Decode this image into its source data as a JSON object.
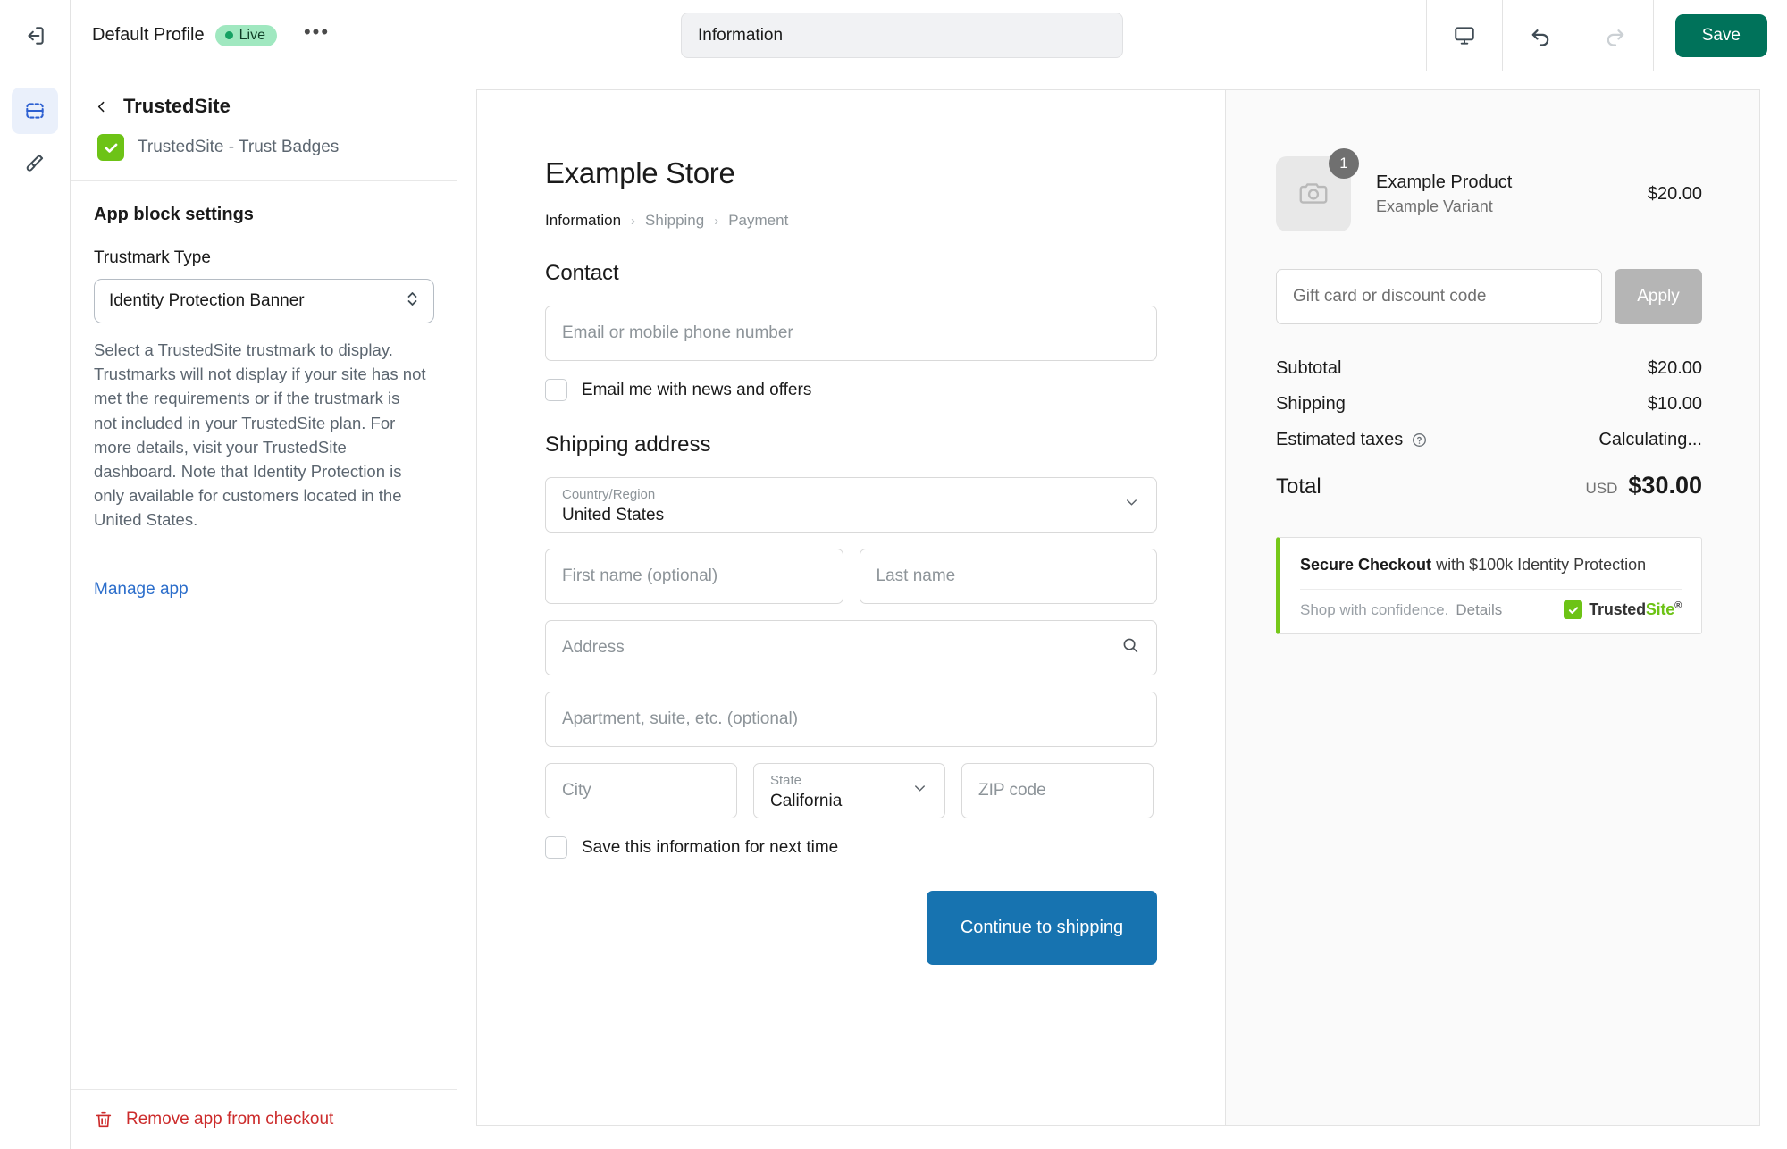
{
  "topbar": {
    "exit_icon": "exit-icon",
    "profile_name": "Default Profile",
    "status_label": "Live",
    "more_label": "•••",
    "page_selector_value": "Information",
    "preview_device_icon": "desktop-icon",
    "undo_icon": "undo-icon",
    "redo_icon": "redo-icon",
    "save_label": "Save"
  },
  "rail": {
    "items": [
      {
        "icon": "sections-icon",
        "name": "sections",
        "active": true
      },
      {
        "icon": "paintbrush-icon",
        "name": "design",
        "active": false
      }
    ]
  },
  "sidebar": {
    "back_icon": "chevron-left-icon",
    "title": "TrustedSite",
    "app_badge_icon": "trustedsite-check-icon",
    "app_name": "TrustedSite - Trust Badges",
    "section_title": "App block settings",
    "trustmark_label": "Trustmark Type",
    "trustmark_value": "Identity Protection Banner",
    "trustmark_options": [
      "Identity Protection Banner"
    ],
    "help_text": "Select a TrustedSite trustmark to display. Trustmarks will not display if your site has not met the requirements or if the trustmark is not included in your TrustedSite plan. For more details, visit your TrustedSite dashboard. Note that Identity Protection is only available for customers located in the United States.",
    "manage_app_label": "Manage app",
    "remove_label": "Remove app from checkout",
    "remove_icon": "trash-icon"
  },
  "checkout": {
    "store_name": "Example Store",
    "breadcrumb": [
      {
        "label": "Information",
        "active": true
      },
      {
        "label": "Shipping",
        "active": false
      },
      {
        "label": "Payment",
        "active": false
      }
    ],
    "breadcrumb_sep": "›",
    "contact_title": "Contact",
    "email_placeholder": "Email or mobile phone number",
    "newsletter_label": "Email me with news and offers",
    "shipping_title": "Shipping address",
    "country_label": "Country/Region",
    "country_value": "United States",
    "first_name_placeholder": "First name (optional)",
    "last_name_placeholder": "Last name",
    "address_placeholder": "Address",
    "address_icon": "search-icon",
    "apartment_placeholder": "Apartment, suite, etc. (optional)",
    "city_placeholder": "City",
    "state_label": "State",
    "state_value": "California",
    "zip_placeholder": "ZIP code",
    "save_info_label": "Save this information for next time",
    "continue_label": "Continue to shipping"
  },
  "summary": {
    "product_thumb_icon": "camera-placeholder-icon",
    "product_qty": "1",
    "product_name": "Example Product",
    "product_variant": "Example Variant",
    "product_price": "$20.00",
    "discount_placeholder": "Gift card or discount code",
    "apply_label": "Apply",
    "lines": [
      {
        "label": "Subtotal",
        "value": "$20.00",
        "info_icon": false
      },
      {
        "label": "Shipping",
        "value": "$10.00",
        "info_icon": false
      },
      {
        "label": "Estimated taxes",
        "value": "Calculating...",
        "info_icon": true
      }
    ],
    "total_label": "Total",
    "total_currency": "USD",
    "total_value": "$30.00",
    "trust_banner": {
      "headline_strong": "Secure Checkout",
      "headline_rest": " with $100k Identity Protection",
      "subtext": "Shop with confidence.",
      "details_label": "Details",
      "logo_trusted": "Trusted",
      "logo_site": "Site",
      "logo_reg": "®"
    }
  },
  "colors": {
    "save_green": "#00725a",
    "live_pill": "#a0e8c0",
    "trustedsite_green": "#6dc316",
    "continue_blue": "#1773b0",
    "link_blue": "#2c6ecb",
    "danger_red": "#cc2b2b"
  }
}
